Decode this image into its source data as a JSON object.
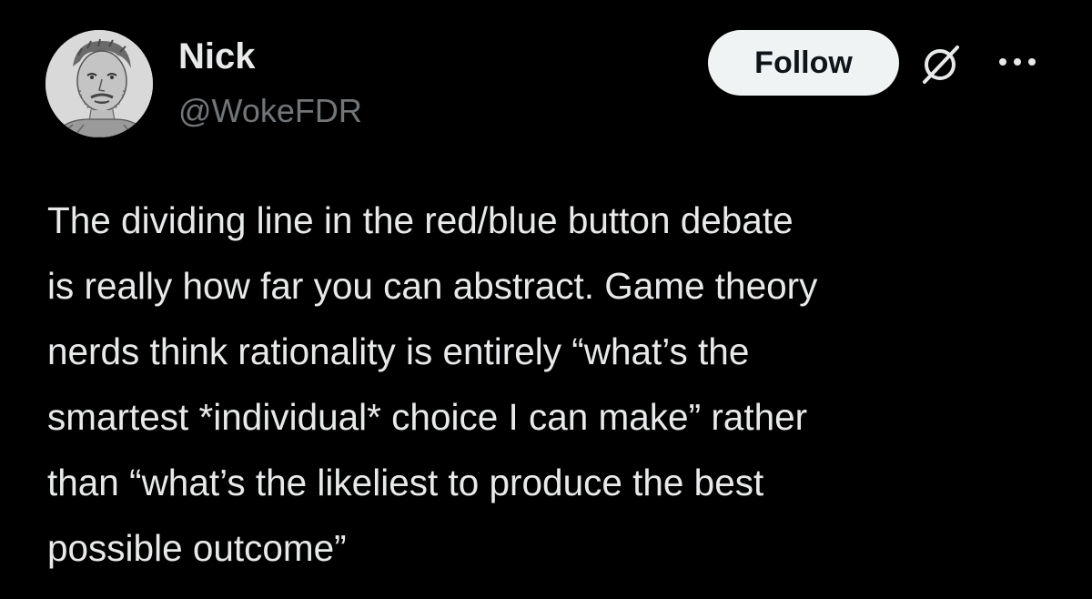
{
  "author": {
    "display_name": "Nick",
    "handle": "@WokeFDR",
    "avatar_icon": "sketched-portrait-avatar"
  },
  "actions": {
    "follow_label": "Follow",
    "grok_icon": "grok-slash-icon",
    "more_icon": "more-dots-icon"
  },
  "tweet": {
    "lines": [
      "The dividing line in the red/blue button debate",
      "is really how far you can abstract. Game theory",
      "nerds think rationality is entirely “what’s the",
      "smartest *individual* choice I can make” rather",
      "than “what’s the likeliest to produce the best",
      "possible outcome”"
    ]
  },
  "colors": {
    "background": "#000000",
    "primary_text": "#e7e9ea",
    "secondary_text": "#71767b",
    "follow_button_bg": "#eff3f4",
    "follow_button_text": "#0f1419"
  }
}
